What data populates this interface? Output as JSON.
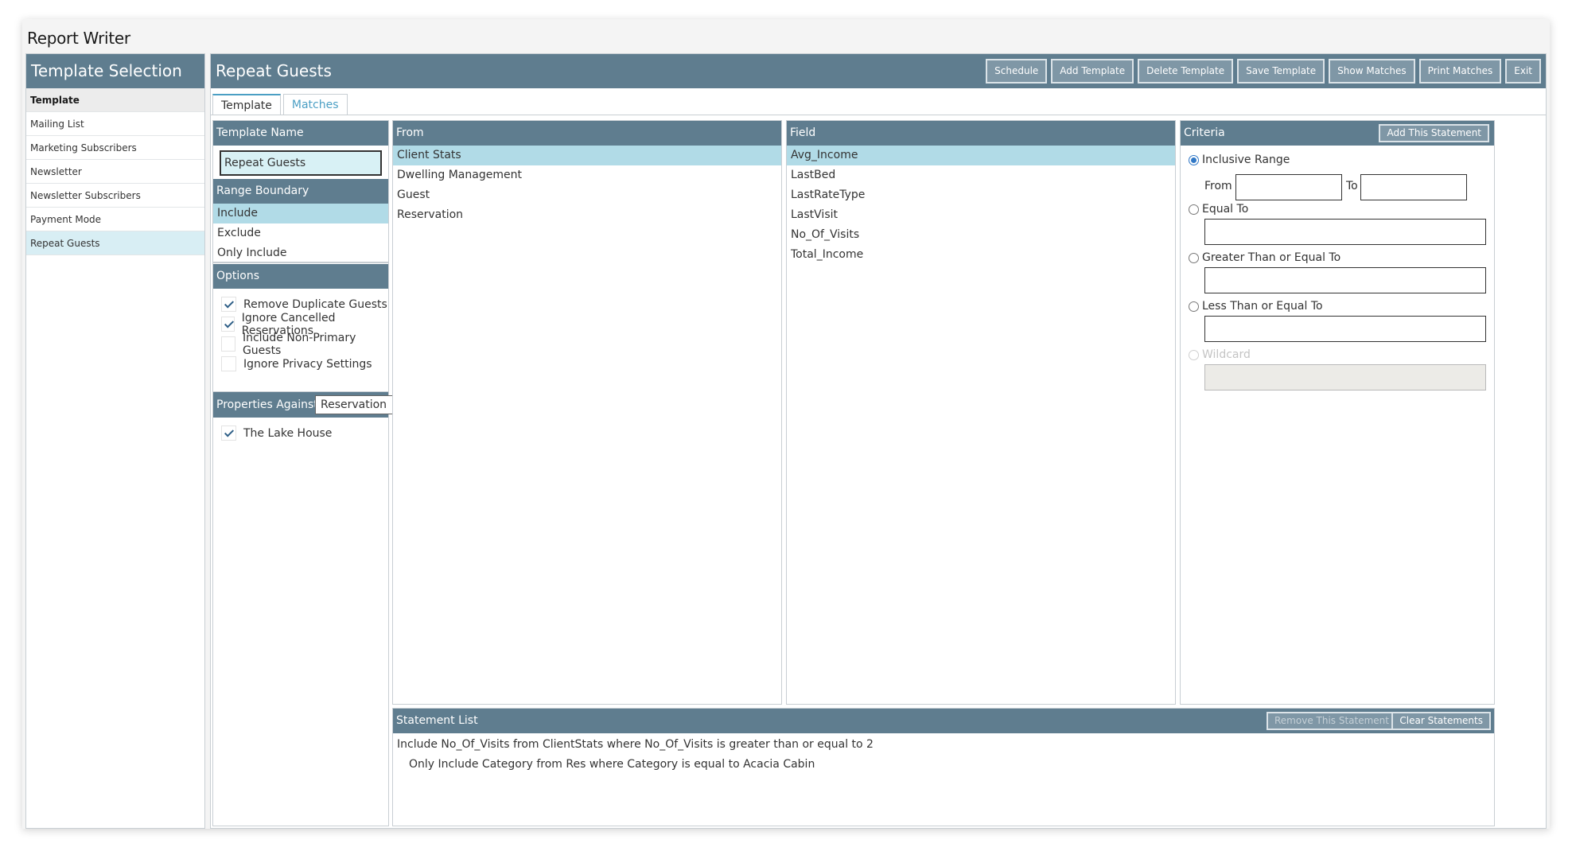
{
  "app": {
    "title": "Report Writer"
  },
  "sidebar": {
    "header": "Template Selection",
    "items": [
      {
        "label": "Template"
      },
      {
        "label": "Mailing List"
      },
      {
        "label": "Marketing Subscribers"
      },
      {
        "label": "Newsletter"
      },
      {
        "label": "Newsletter Subscribers"
      },
      {
        "label": "Payment Mode"
      },
      {
        "label": "Repeat Guests"
      }
    ]
  },
  "main": {
    "title": "Repeat Guests",
    "toolbar": {
      "schedule": "Schedule",
      "add_template": "Add Template",
      "delete_template": "Delete Template",
      "save_template": "Save Template",
      "show_matches": "Show Matches",
      "print_matches": "Print Matches",
      "exit": "Exit"
    },
    "tabs": [
      {
        "label": "Template"
      },
      {
        "label": "Matches"
      }
    ]
  },
  "template_name": {
    "header": "Template Name",
    "value": "Repeat Guests"
  },
  "range_boundary": {
    "header": "Range Boundary",
    "items": [
      {
        "label": "Include"
      },
      {
        "label": "Exclude"
      },
      {
        "label": "Only Include"
      }
    ]
  },
  "options": {
    "header": "Options",
    "items": [
      {
        "label": "Remove Duplicate Guests",
        "checked": true
      },
      {
        "label": "Ignore Cancelled Reservations",
        "checked": true
      },
      {
        "label": "Include Non-Primary Guests",
        "checked": false
      },
      {
        "label": "Ignore Privacy Settings",
        "checked": false
      }
    ]
  },
  "properties": {
    "header": "Properties Against",
    "selected": "Reservation",
    "items": [
      {
        "label": "The Lake House",
        "checked": true
      }
    ]
  },
  "from": {
    "header": "From",
    "items": [
      {
        "label": "Client Stats"
      },
      {
        "label": "Dwelling Management"
      },
      {
        "label": "Guest"
      },
      {
        "label": "Reservation"
      }
    ]
  },
  "field": {
    "header": "Field",
    "items": [
      {
        "label": "Avg_Income"
      },
      {
        "label": "LastBed"
      },
      {
        "label": "LastRateType"
      },
      {
        "label": "LastVisit"
      },
      {
        "label": "No_Of_Visits"
      },
      {
        "label": "Total_Income"
      }
    ]
  },
  "criteria": {
    "header": "Criteria",
    "add_button": "Add This Statement",
    "inclusive_range": "Inclusive Range",
    "from_label": "From",
    "to_label": "To",
    "equal_to": "Equal To",
    "gte": "Greater Than or Equal To",
    "lte": "Less Than or Equal To",
    "wildcard": "Wildcard"
  },
  "statements": {
    "header": "Statement List",
    "remove_button": "Remove This Statement",
    "clear_button": "Clear Statements",
    "items": [
      {
        "text": "Include No_Of_Visits from ClientStats where No_Of_Visits is greater than or equal to 2"
      },
      {
        "text": "Only Include Category from Res where Category is equal to Acacia Cabin"
      }
    ]
  }
}
